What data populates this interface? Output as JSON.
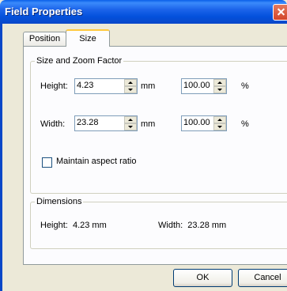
{
  "window": {
    "title": "Field Properties"
  },
  "tabs": [
    {
      "label": "Position"
    },
    {
      "label": "Size"
    }
  ],
  "size_group": {
    "legend": "Size and Zoom Factor",
    "height_label": "Height:",
    "height_value": "4.23",
    "height_unit": "mm",
    "height_zoom": "100.00",
    "height_zoom_unit": "%",
    "width_label": "Width:",
    "width_value": "23.28",
    "width_unit": "mm",
    "width_zoom": "100.00",
    "width_zoom_unit": "%",
    "aspect_label": "Maintain aspect ratio",
    "aspect_checked": false
  },
  "dimensions": {
    "legend": "Dimensions",
    "height_text": "Height:  4.23 mm",
    "width_text": "Width:  23.28 mm"
  },
  "buttons": {
    "ok": "OK",
    "cancel": "Cancel"
  },
  "colors": {
    "titlebar": "#0a5fe8",
    "close": "#d2452a",
    "tab_highlight": "#ffc83c"
  }
}
